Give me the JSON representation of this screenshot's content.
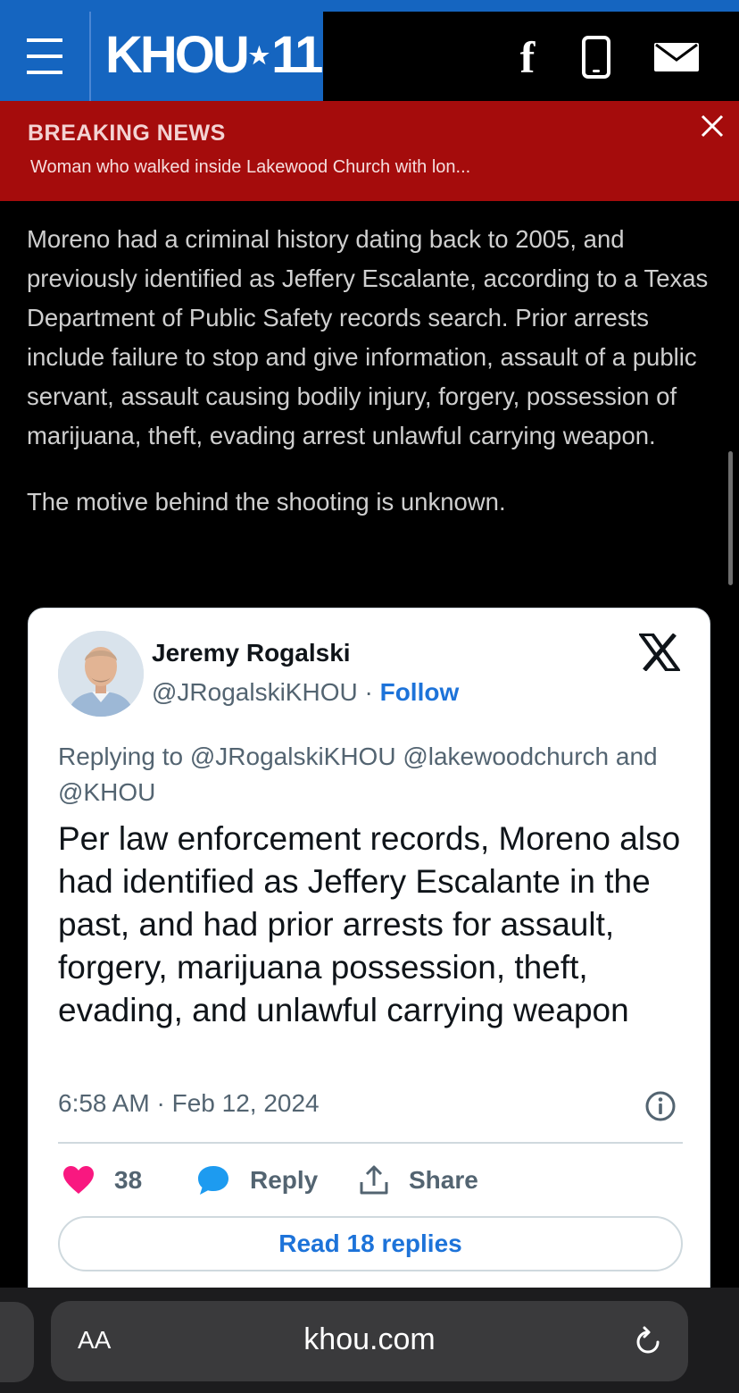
{
  "header": {
    "logo_text": "KHOU",
    "logo_star": "★",
    "logo_number": "11",
    "facebook_glyph": "f",
    "brand_color": "#1565c0"
  },
  "breaking": {
    "title": "BREAKING NEWS",
    "headline": "Woman who walked inside Lakewood Church with lon...",
    "background_color": "#a50c0c"
  },
  "article": {
    "paragraphs": [
      "Moreno had a criminal history dating back to 2005, and previously identified as Jeffery Escalante, according to a Texas Department of Public Safety records search. Prior arrests include failure to stop and give information, assault of a public servant, assault causing bodily injury, forgery, possession of marijuana, theft, evading arrest unlawful carrying weapon.",
      "The motive behind the shooting is unknown."
    ]
  },
  "tweet": {
    "author_name": "Jeremy Rogalski",
    "author_handle": "@JRogalskiKHOU",
    "separator": " · ",
    "follow_label": "Follow",
    "reply_to": "Replying to @JRogalskiKHOU @lakewoodchurch and @KHOU",
    "text": "Per law enforcement records, Moreno also had identified as Jeffery Escalante in the past, and had prior arrests for assault, forgery, marijuana possession, theft, evading, and unlawful carrying weapon",
    "timestamp": "6:58 AM · Feb 12, 2024",
    "like_count": "38",
    "reply_label": "Reply",
    "share_label": "Share",
    "read_replies_label": "Read 18 replies",
    "like_color": "#f91880",
    "reply_color": "#1d9bf0",
    "link_color": "#1d73d9"
  },
  "browser": {
    "aa_label": "AA",
    "url": "khou.com"
  },
  "icons": [
    "menu-icon",
    "facebook-icon",
    "phone-icon",
    "mail-icon",
    "close-icon",
    "x-logo-icon",
    "info-icon",
    "heart-icon",
    "reply-bubble-icon",
    "share-icon",
    "reload-icon"
  ]
}
